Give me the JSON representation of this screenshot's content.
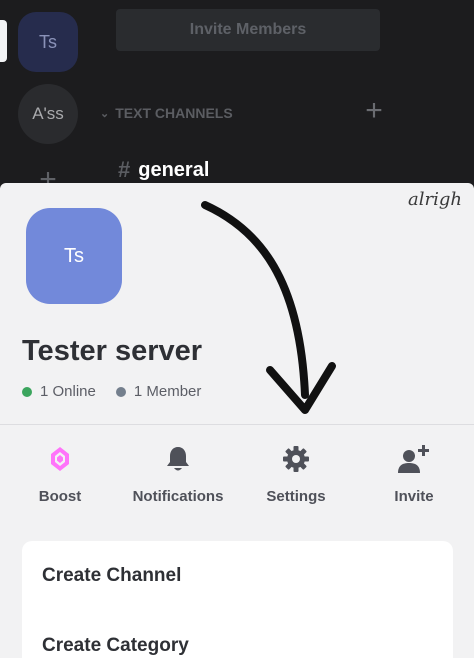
{
  "background": {
    "servers": [
      {
        "abbr": "Ts"
      },
      {
        "abbr": "A'ss"
      }
    ],
    "add_server_icon": "plus-icon",
    "invite_members_label": "Invite Members",
    "category_label": "TEXT CHANNELS",
    "channel_name": "general"
  },
  "sheet": {
    "signature": "alrigh",
    "server_icon_text": "Ts",
    "server_name": "Tester server",
    "online_text": "1 Online",
    "member_text": "1 Member",
    "actions": [
      {
        "label": "Boost",
        "icon": "boost-gem-icon"
      },
      {
        "label": "Notifications",
        "icon": "bell-icon"
      },
      {
        "label": "Settings",
        "icon": "gear-icon"
      },
      {
        "label": "Invite",
        "icon": "add-user-icon"
      }
    ],
    "menu": [
      {
        "label": "Create Channel"
      },
      {
        "label": "Create Category"
      }
    ]
  },
  "colors": {
    "accent": "#7289da",
    "online": "#3ba55d",
    "boost": "#ff73fa"
  }
}
